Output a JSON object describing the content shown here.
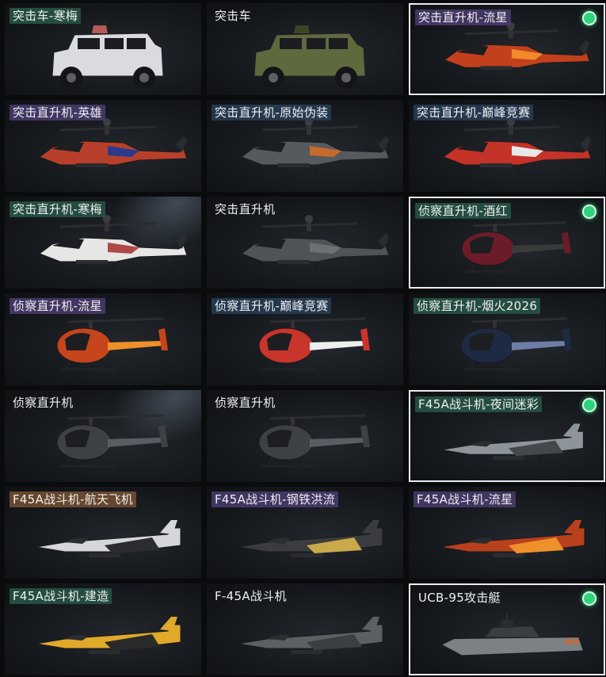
{
  "colors": {
    "check": "#2ed47a",
    "selected_border": "#e9ecef",
    "background": "#0a0b0d"
  },
  "items": [
    {
      "label": "突击车-寒梅",
      "tag": "teal",
      "selected": false,
      "kind": "car",
      "skin": "#d9dbde",
      "accent": "#b45a5a"
    },
    {
      "label": "突击车",
      "tag": "none",
      "selected": false,
      "kind": "car",
      "skin": "#5e6a3e",
      "accent": "#3d4528"
    },
    {
      "label": "突击直升机-流星",
      "tag": "purple",
      "selected": true,
      "kind": "attack",
      "skin": "#c2411c",
      "accent": "#f08a2a"
    },
    {
      "label": "突击直升机-英雄",
      "tag": "purple",
      "selected": false,
      "kind": "attack",
      "skin": "#b8402a",
      "accent": "#2b3b8c"
    },
    {
      "label": "突击直升机-原始伪装",
      "tag": "blue",
      "selected": false,
      "kind": "attack",
      "skin": "#555a5e",
      "accent": "#c46a2b"
    },
    {
      "label": "突击直升机-巅峰竞赛",
      "tag": "blue",
      "selected": false,
      "kind": "attack",
      "skin": "#c43228",
      "accent": "#e8e8e8"
    },
    {
      "label": "突击直升机-寒梅",
      "tag": "teal",
      "selected": false,
      "kind": "attack",
      "skin": "#e6e6e6",
      "accent": "#b04848",
      "lit": true
    },
    {
      "label": "突击直升机",
      "tag": "none",
      "selected": false,
      "kind": "attack",
      "skin": "#4f5357",
      "accent": "#6b7075"
    },
    {
      "label": "侦察直升机-酒红",
      "tag": "teal",
      "selected": true,
      "kind": "scout",
      "skin": "#6b1c28",
      "accent": "#3a3a3a"
    },
    {
      "label": "侦察直升机-流星",
      "tag": "purple",
      "selected": false,
      "kind": "scout",
      "skin": "#c6451c",
      "accent": "#f0902a"
    },
    {
      "label": "侦察直升机-巅峰竞赛",
      "tag": "blue",
      "selected": false,
      "kind": "scout",
      "skin": "#c9342b",
      "accent": "#eeeeee"
    },
    {
      "label": "侦察直升机-烟火2026",
      "tag": "teal",
      "selected": false,
      "kind": "scout",
      "skin": "#1e2a44",
      "accent": "#6d7ea6"
    },
    {
      "label": "侦察直升机",
      "tag": "none",
      "selected": false,
      "kind": "scout",
      "skin": "#3d4044",
      "accent": "#5a5e63",
      "lit": true
    },
    {
      "label": "侦察直升机",
      "tag": "none",
      "selected": false,
      "kind": "scout",
      "skin": "#3d4044",
      "accent": "#5a5e63"
    },
    {
      "label": "F45A战斗机-夜间迷彩",
      "tag": "teal",
      "selected": true,
      "kind": "jet",
      "skin": "#8e949b",
      "accent": "#44484d"
    },
    {
      "label": "F45A战斗机-航天飞机",
      "tag": "brown",
      "selected": false,
      "kind": "jet",
      "skin": "#d4d6d9",
      "accent": "#2a2c2f"
    },
    {
      "label": "F45A战斗机-钢铁洪流",
      "tag": "purple",
      "selected": false,
      "kind": "jet",
      "skin": "#3a3c3f",
      "accent": "#c9a94a"
    },
    {
      "label": "F45A战斗机-流星",
      "tag": "purple",
      "selected": false,
      "kind": "jet",
      "skin": "#b8401c",
      "accent": "#f0902a"
    },
    {
      "label": "F45A战斗机-建造",
      "tag": "teal",
      "selected": false,
      "kind": "jet",
      "skin": "#e0a92a",
      "accent": "#2a2a2a"
    },
    {
      "label": "F-45A战斗机",
      "tag": "none",
      "selected": false,
      "kind": "jet",
      "skin": "#5c6065",
      "accent": "#3b3e42"
    },
    {
      "label": "UCB-95攻击艇",
      "tag": "none",
      "selected": true,
      "kind": "boat",
      "skin": "#7c8186",
      "accent": "#3a3d41"
    }
  ]
}
